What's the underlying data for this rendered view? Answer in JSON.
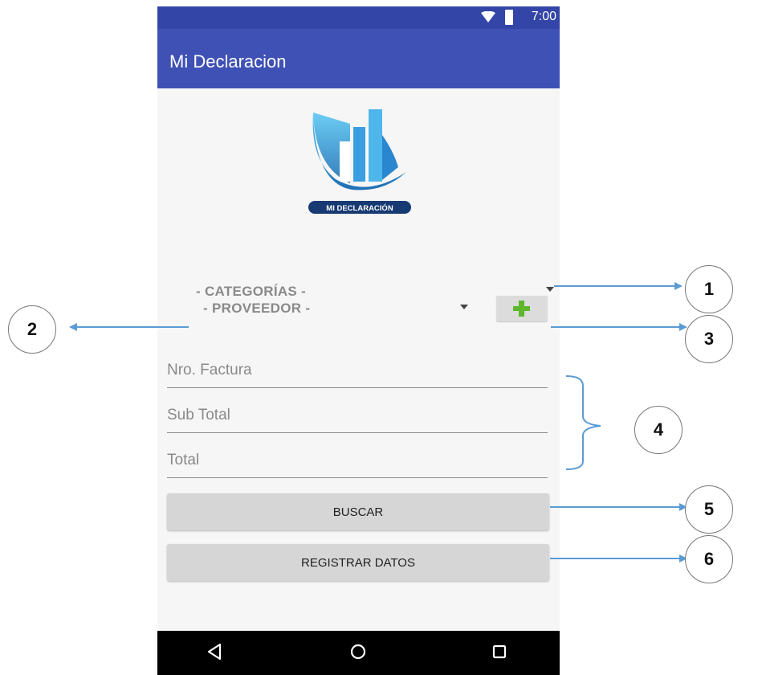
{
  "status_bar": {
    "time": "7:00"
  },
  "app_bar": {
    "title": "Mi Declaracion"
  },
  "logo": {
    "label": "MI DECLARACIÓN"
  },
  "form": {
    "category_spinner": "- CATEGORÍAS -",
    "provider_spinner": "- PROVEEDOR -",
    "add_button_symbol": "+",
    "invoice_hint": "Nro. Factura",
    "subtotal_hint": "Sub Total",
    "total_hint": "Total",
    "search_button": "BUSCAR",
    "register_button": "REGISTRAR DATOS"
  },
  "annotations": [
    "1",
    "2",
    "3",
    "4",
    "5",
    "6"
  ],
  "colors": {
    "status_bar": "#3345a6",
    "app_bar": "#3f51b5",
    "accent_plus": "#5cb82a",
    "arrow": "#5b9bd5"
  },
  "icons": [
    "wifi-icon",
    "battery-icon",
    "back-icon",
    "home-icon",
    "recents-icon",
    "plus-icon"
  ]
}
